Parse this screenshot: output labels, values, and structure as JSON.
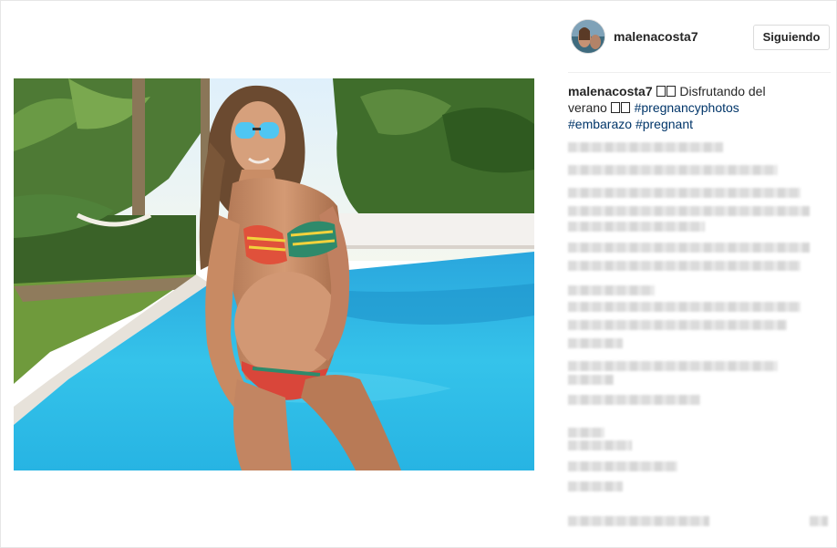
{
  "post": {
    "username": "malenacosta7",
    "follow_label": "Siguiendo",
    "caption": {
      "username": "malenacosta7",
      "text": "Disfrutando del verano",
      "hashtags": [
        "#pregnancyphotos",
        "#embarazo",
        "#pregnant"
      ]
    }
  },
  "colors": {
    "pool": "#29b6e6",
    "sky": "#eaf4fb",
    "foliage": "#3d6b2a",
    "link": "#003569"
  },
  "comments_visible": false
}
